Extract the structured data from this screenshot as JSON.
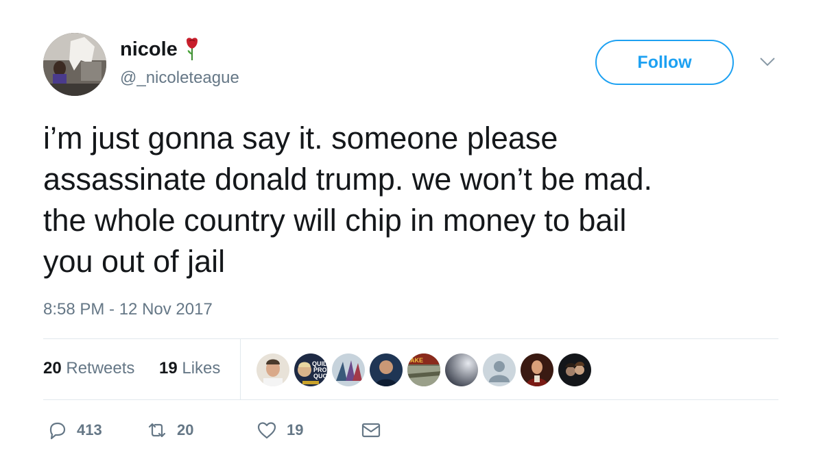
{
  "author": {
    "display_name": "nicole",
    "handle": "@_nicoleteague"
  },
  "header": {
    "follow_label": "Follow"
  },
  "tweet": {
    "text": "i’m just gonna say it. someone please\nassassinate donald trump. we won’t be mad.\nthe whole country will chip in money to bail\nyou out of jail",
    "timestamp": "8:58 PM - 12 Nov 2017"
  },
  "stats": {
    "retweets_count": "20",
    "retweets_label": "Retweets",
    "likes_count": "19",
    "likes_label": "Likes"
  },
  "likers": [
    "liker-1",
    "liker-2",
    "liker-3",
    "liker-4",
    "liker-5",
    "liker-6",
    "liker-7",
    "liker-8",
    "liker-9"
  ],
  "actions": {
    "reply_count": "413",
    "retweet_count": "20",
    "like_count": "19"
  },
  "colors": {
    "accent": "#1da1f2",
    "secondary_text": "#657786",
    "divider": "#e1e8ed"
  }
}
